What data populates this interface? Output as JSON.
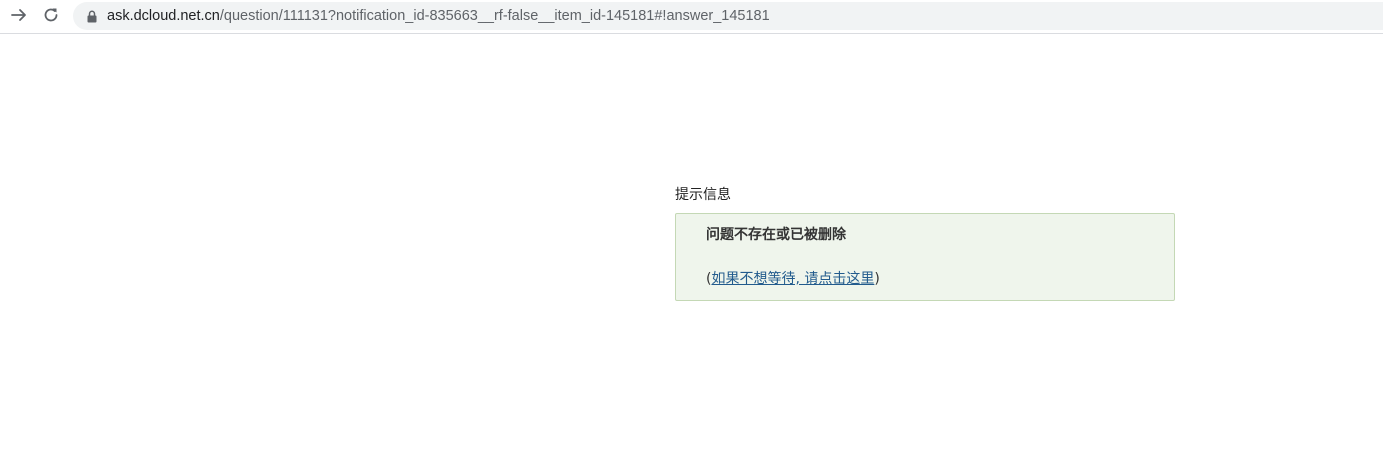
{
  "browser": {
    "url_host": "ask.dcloud.net.cn",
    "url_path": "/question/111131?notification_id-835663__rf-false__item_id-145181#!answer_145181",
    "icons": {
      "forward": "arrow-forward-icon",
      "reload": "reload-icon",
      "lock": "lock-icon"
    }
  },
  "notice": {
    "title": "提示信息",
    "message": "问题不存在或已被删除",
    "paren_open": "(",
    "link_text": "如果不想等待, 请点击这里",
    "paren_close": ")"
  },
  "colors": {
    "box_bg": "#eff5ec",
    "box_border": "#c4d8b5",
    "link": "#225b8d"
  }
}
